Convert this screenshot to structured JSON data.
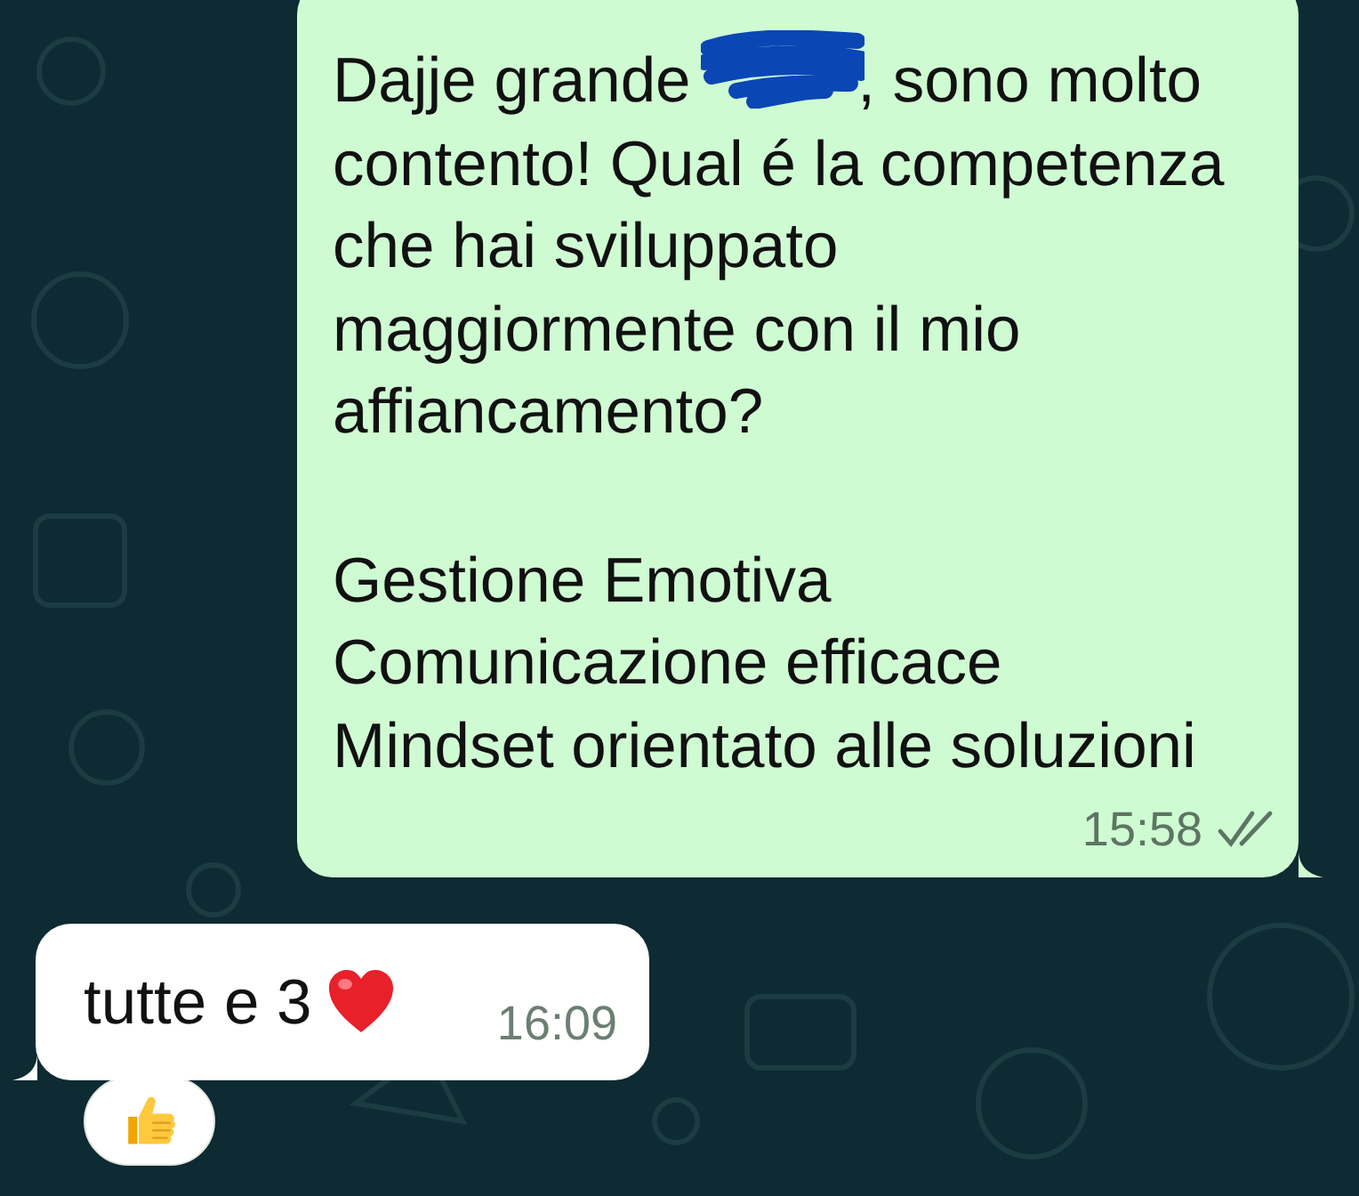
{
  "messages": [
    {
      "kind": "outgoing",
      "text_before_redaction": "Dajje grande",
      "redacted": true,
      "text_after_redaction": ", sono molto contento! Qual é la competenza che hai sviluppato maggiormente con il mio affiancamento?",
      "list": [
        "Gestione Emotiva",
        "Comunicazione efficace",
        "Mindset orientato alle soluzioni"
      ],
      "time": "15:58",
      "delivered": true,
      "read": false
    },
    {
      "kind": "incoming",
      "text": "tutte e 3",
      "heart_emoji": true,
      "time": "16:09",
      "thumbs_up_reaction": true
    }
  ]
}
